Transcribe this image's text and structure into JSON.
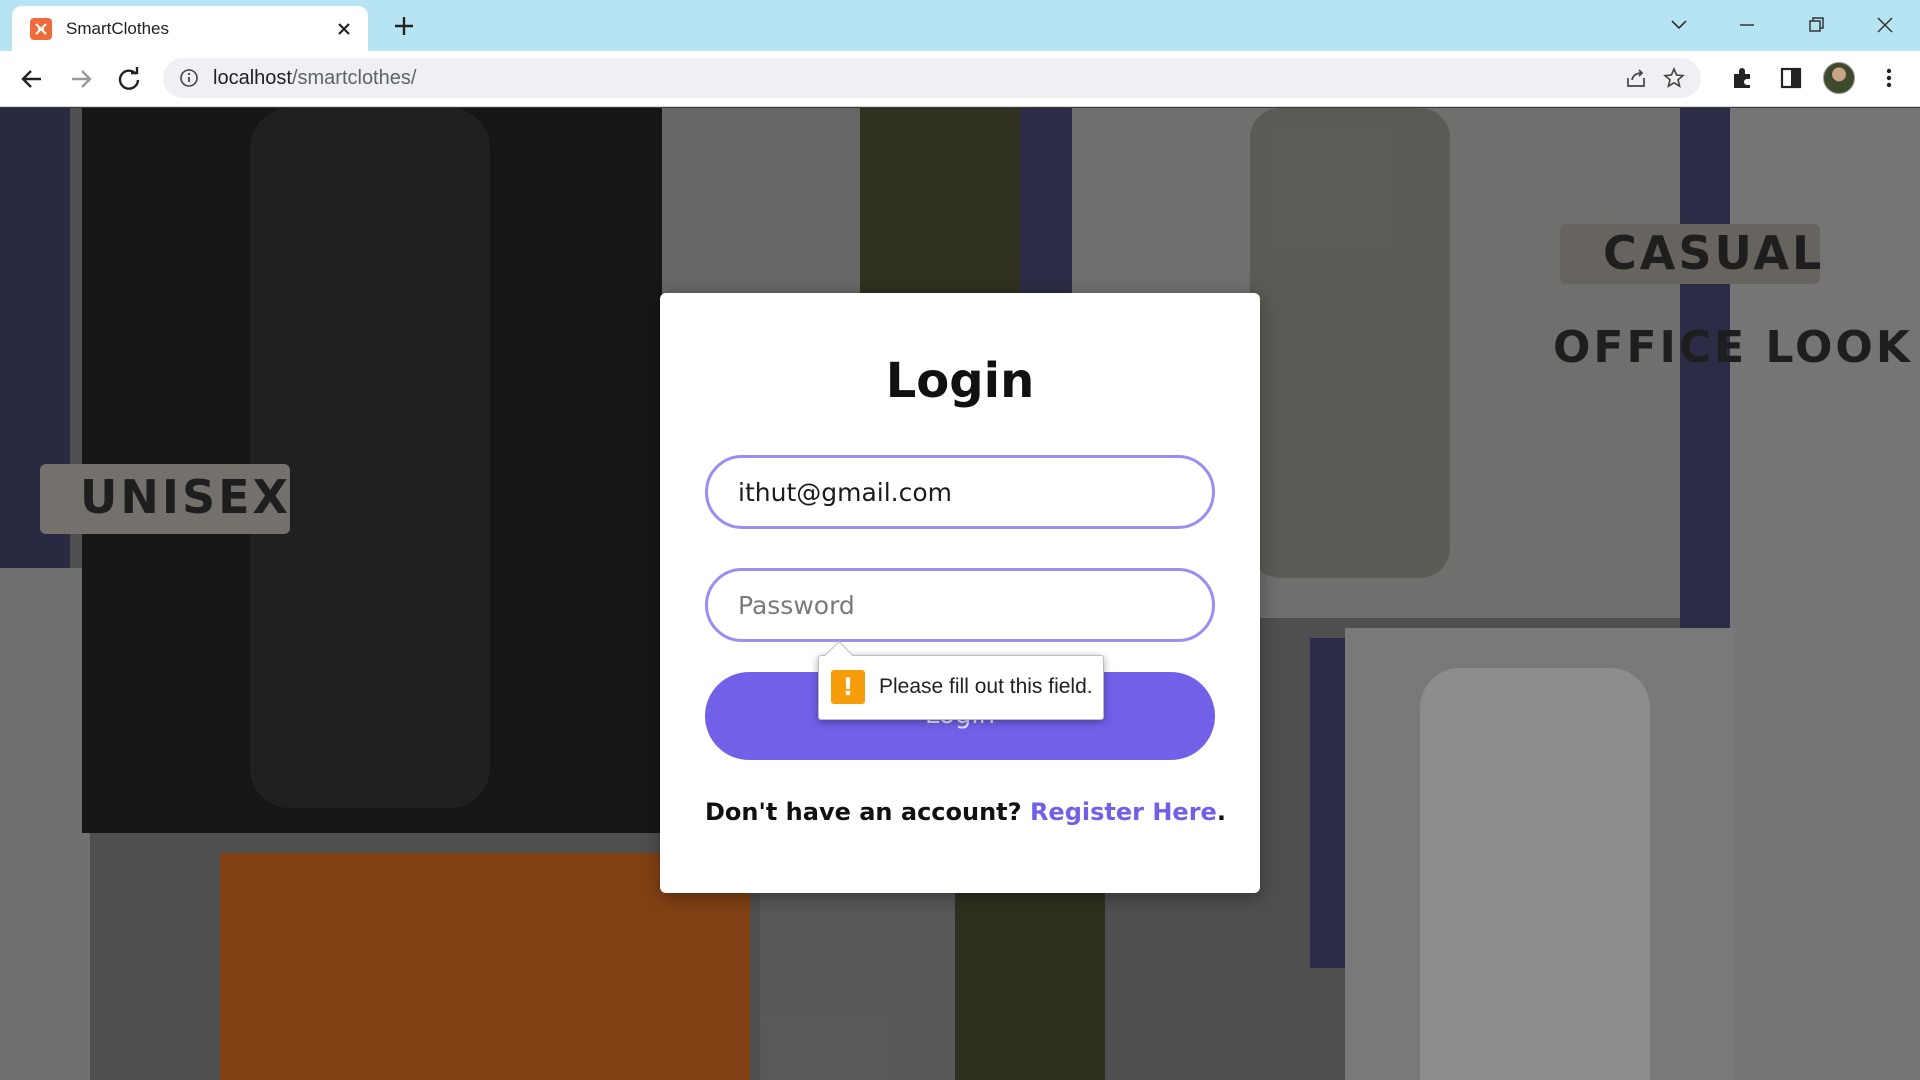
{
  "browser": {
    "tab": {
      "title": "SmartClothes",
      "favicon": "xampp-icon"
    },
    "address": {
      "host": "localhost",
      "path": "/smartclothes/"
    },
    "icons": {
      "back": "back-arrow-icon",
      "forward": "forward-arrow-icon",
      "reload": "reload-icon",
      "info": "info-icon",
      "share": "share-icon",
      "bookmark": "star-icon",
      "extensions": "puzzle-icon",
      "sidepanel": "side-panel-icon",
      "menu": "more-vert-icon"
    }
  },
  "background": {
    "labels": {
      "left": "UNISEX",
      "right_top": "CASUAL",
      "right_bottom": "OFFICE LOOK"
    }
  },
  "login": {
    "title": "Login",
    "email_value": "ithut@gmail.com",
    "password_placeholder": "Password",
    "submit_label": "Login",
    "register_prompt": "Don't have an account?",
    "register_link": "Register Here",
    "register_suffix": "."
  },
  "validation": {
    "message": "Please fill out this field.",
    "icon": "warning-icon",
    "icon_color": "#f59d0b"
  },
  "colors": {
    "accent": "#7160e8",
    "input_border": "#9b8ef0",
    "titlebar": "#b7e4f2"
  }
}
